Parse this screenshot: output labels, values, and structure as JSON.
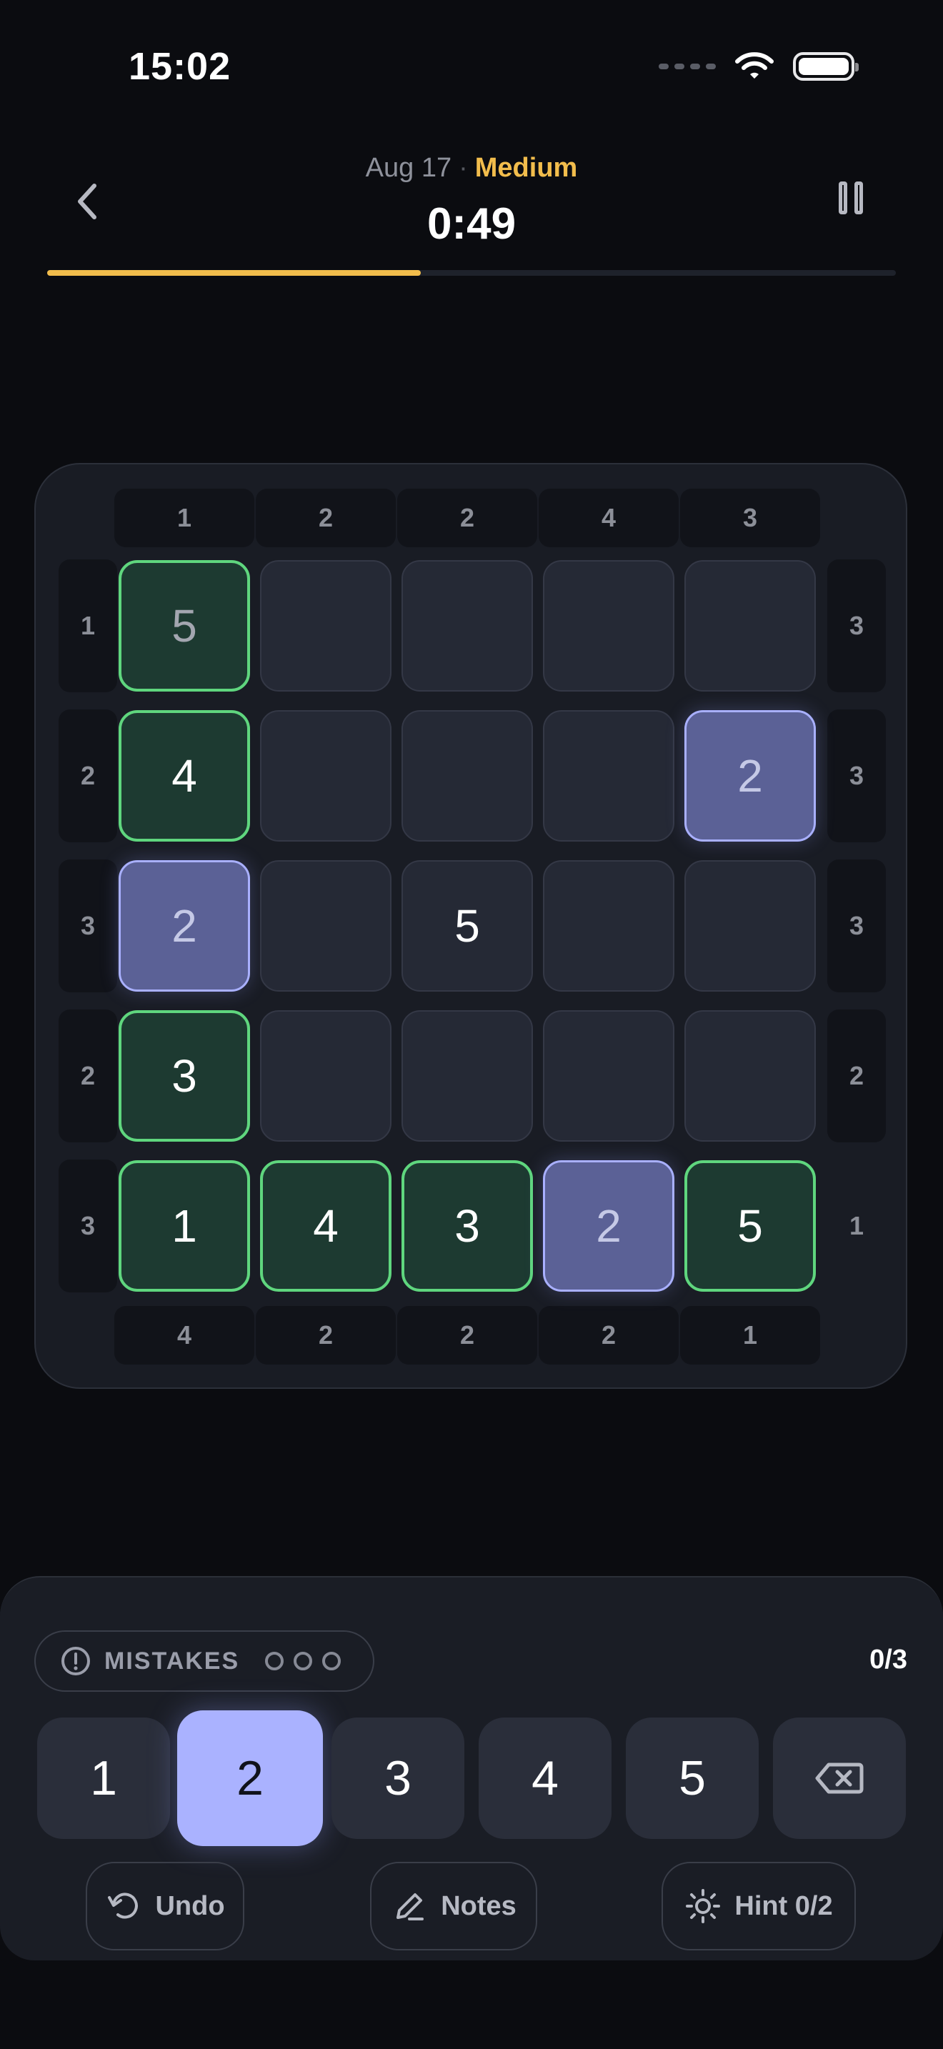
{
  "status": {
    "time": "15:02"
  },
  "header": {
    "date": "Aug 17",
    "separator": "·",
    "difficulty": "Medium",
    "timer": "0:49",
    "progress_percent": 44
  },
  "board": {
    "top_clues": [
      "1",
      "2",
      "2",
      "4",
      "3"
    ],
    "bottom_clues": [
      "4",
      "2",
      "2",
      "2",
      "1"
    ],
    "left_clues": [
      "1",
      "2",
      "3",
      "2",
      "3"
    ],
    "right_clues": [
      "3",
      "3",
      "3",
      "2",
      "1"
    ],
    "rows": [
      [
        {
          "v": "5",
          "s": "given"
        },
        {
          "v": "",
          "s": "empty"
        },
        {
          "v": "",
          "s": "empty"
        },
        {
          "v": "",
          "s": "empty"
        },
        {
          "v": "",
          "s": "empty"
        }
      ],
      [
        {
          "v": "4",
          "s": "given"
        },
        {
          "v": "",
          "s": "empty"
        },
        {
          "v": "",
          "s": "empty"
        },
        {
          "v": "",
          "s": "empty"
        },
        {
          "v": "2",
          "s": "selected"
        }
      ],
      [
        {
          "v": "2",
          "s": "selected"
        },
        {
          "v": "",
          "s": "empty"
        },
        {
          "v": "5",
          "s": "filled"
        },
        {
          "v": "",
          "s": "empty"
        },
        {
          "v": "",
          "s": "empty"
        }
      ],
      [
        {
          "v": "3",
          "s": "given"
        },
        {
          "v": "",
          "s": "empty"
        },
        {
          "v": "",
          "s": "empty"
        },
        {
          "v": "",
          "s": "empty"
        },
        {
          "v": "",
          "s": "empty"
        }
      ],
      [
        {
          "v": "1",
          "s": "given"
        },
        {
          "v": "4",
          "s": "given"
        },
        {
          "v": "3",
          "s": "given"
        },
        {
          "v": "2",
          "s": "selected"
        },
        {
          "v": "5",
          "s": "given"
        }
      ]
    ]
  },
  "panel": {
    "mistakes_label": "MISTAKES",
    "score": "0/3",
    "keys": [
      "1",
      "2",
      "3",
      "4",
      "5"
    ],
    "active_key": "2",
    "undo_label": "Undo",
    "notes_label": "Notes",
    "hint_label": "Hint 0/2"
  },
  "icons": {
    "back": "chevron-left-icon",
    "pause": "pause-icon",
    "delete": "backspace-icon",
    "undo": "undo-icon",
    "notes": "pencil-icon",
    "hint": "sun-icon",
    "mistakes": "alert-icon"
  },
  "colors": {
    "accent": "#f2bd4c",
    "given_border": "#5fd67e",
    "selected_fill": "#5b6196",
    "active_key": "#aab2ff"
  }
}
